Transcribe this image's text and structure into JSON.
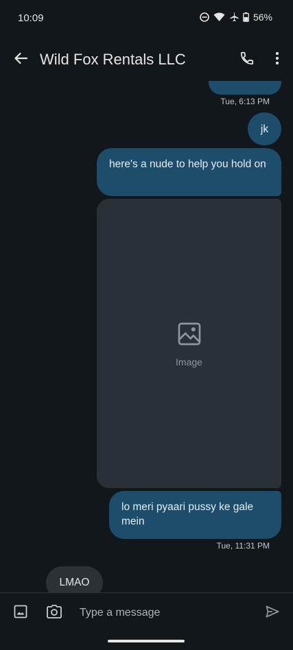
{
  "status_bar": {
    "time": "10:09",
    "battery": "56%"
  },
  "app_bar": {
    "title": "Wild Fox Rentals LLC"
  },
  "messages": {
    "jk": "jk",
    "text2": "here's a nude to help you hold on",
    "text3": "lo meri pyaari pussy ke gale mein",
    "incoming": "LMAO",
    "ts_1": "Tue, 6:13 PM",
    "ts_2": "Tue, 11:31 PM",
    "image_placeholder": "Image"
  },
  "composer": {
    "placeholder": "Type a message"
  },
  "colors": {
    "outgoing_bubble": "#1e4d6b",
    "incoming_bubble": "#2b3236",
    "background": "#12171b"
  }
}
